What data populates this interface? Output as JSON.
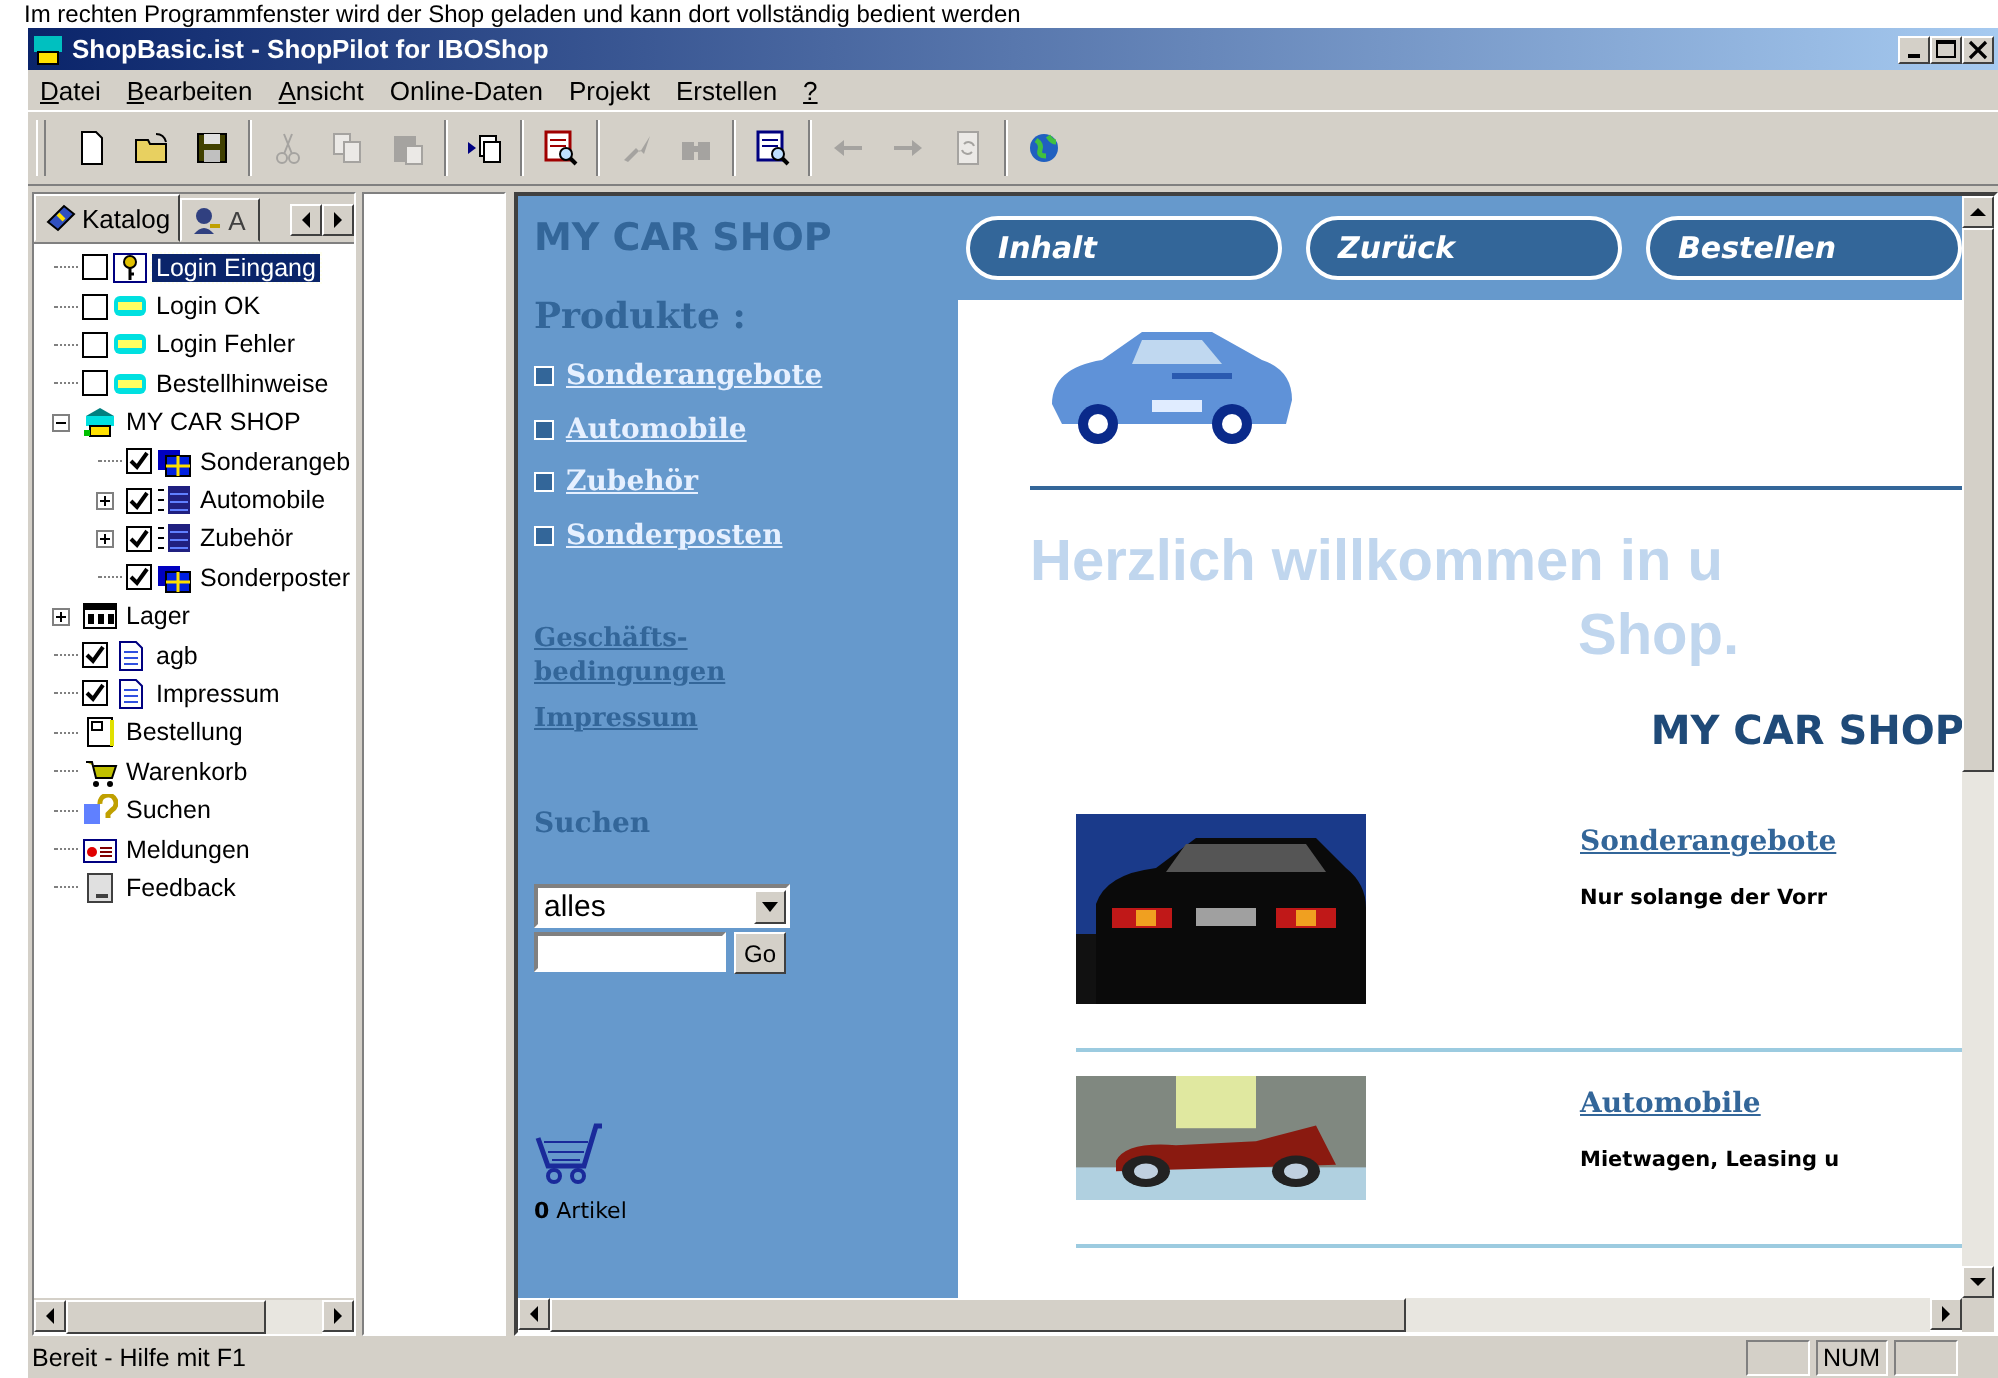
{
  "caption": "Im rechten Programmfenster wird der Shop geladen und kann dort vollständig bedient werden",
  "window": {
    "title": "ShopBasic.ist - ShopPilot for IBOShop"
  },
  "menu": [
    {
      "label": "Datei",
      "underline_first": true
    },
    {
      "label": "Bearbeiten",
      "underline_first": true
    },
    {
      "label": "Ansicht",
      "underline_first": true
    },
    {
      "label": "Online-Daten",
      "underline_first": false
    },
    {
      "label": "Projekt",
      "underline_first": false
    },
    {
      "label": "Erstellen",
      "underline_first": false
    },
    {
      "label": "?",
      "underline_first": true
    }
  ],
  "toolbar": [
    [
      {
        "kind": "new",
        "disabled": false
      },
      {
        "kind": "open",
        "disabled": false
      },
      {
        "kind": "save",
        "disabled": false
      }
    ],
    [
      {
        "kind": "cut",
        "disabled": true
      },
      {
        "kind": "copy",
        "disabled": true
      },
      {
        "kind": "paste",
        "disabled": true
      }
    ],
    [
      {
        "kind": "import",
        "disabled": false
      }
    ],
    [
      {
        "kind": "preview",
        "disabled": false
      }
    ],
    [
      {
        "kind": "tool",
        "disabled": true
      },
      {
        "kind": "find",
        "disabled": true
      }
    ],
    [
      {
        "kind": "view",
        "disabled": false
      }
    ],
    [
      {
        "kind": "back",
        "disabled": true
      },
      {
        "kind": "forward",
        "disabled": true
      },
      {
        "kind": "refresh",
        "disabled": true
      }
    ],
    [
      {
        "kind": "globe",
        "disabled": false
      }
    ]
  ],
  "tabs": [
    {
      "label": "Katalog",
      "selected": true
    },
    {
      "label": "A",
      "selected": false
    }
  ],
  "tree": [
    {
      "label": "Login Eingang",
      "kind": "key",
      "checked": false,
      "selected": true
    },
    {
      "label": "Login OK",
      "kind": "shop",
      "checked": false,
      "selected": false
    },
    {
      "label": "Login Fehler",
      "kind": "shop",
      "checked": false,
      "selected": false
    },
    {
      "label": "Bestellhinweise",
      "kind": "shop",
      "checked": false,
      "selected": false
    },
    {
      "label": "MY CAR SHOP",
      "kind": "store",
      "selected": false,
      "expanded": true,
      "children": [
        {
          "label": "Sonderangeb",
          "kind": "folder",
          "checked": true,
          "selected": false
        },
        {
          "label": "Automobile",
          "kind": "list",
          "checked": true,
          "selected": false,
          "expanded": false
        },
        {
          "label": "Zubehör",
          "kind": "list",
          "checked": true,
          "selected": false,
          "expanded": false
        },
        {
          "label": "Sonderposter",
          "kind": "folder",
          "checked": true,
          "selected": false
        }
      ]
    },
    {
      "label": "Lager",
      "kind": "stock",
      "selected": false,
      "expanded": false
    },
    {
      "label": "agb",
      "kind": "page",
      "checked": true,
      "selected": false
    },
    {
      "label": "Impressum",
      "kind": "page",
      "checked": true,
      "selected": false
    },
    {
      "label": "Bestellung",
      "kind": "form",
      "selected": false
    },
    {
      "label": "Warenkorb",
      "kind": "cart",
      "selected": false
    },
    {
      "label": "Suchen",
      "kind": "search",
      "selected": false
    },
    {
      "label": "Meldungen",
      "kind": "message",
      "selected": false
    },
    {
      "label": "Feedback",
      "kind": "feedback",
      "selected": false
    }
  ],
  "web": {
    "brand": "MY CAR SHOP",
    "nav_buttons": [
      "Inhalt",
      "Zurück",
      "Bestellen"
    ],
    "products_heading": "Produkte :",
    "product_links": [
      "Sonderangebote",
      "Automobile",
      "Zubehör",
      "Sonderposten"
    ],
    "info_links": [
      "Geschäfts-bedingungen",
      "Impressum"
    ],
    "search_heading": "Suchen",
    "search_select": "alles",
    "go_button": "Go",
    "cart_count": "0",
    "cart_label": "Artikel",
    "welcome_lines": [
      "Herzlich willkommen in u",
      "Shop."
    ],
    "subtitle": "MY CAR SHOP",
    "categories": [
      {
        "title": "Sonderangebote",
        "text": "Nur solange der Vorr",
        "kind": "picture"
      },
      {
        "title": "Automobile",
        "text": "Mietwagen, Leasing u",
        "kind": "picture"
      }
    ]
  },
  "status_bar": {
    "text": "Bereit - Hilfe mit F1",
    "indicators": [
      "NUM"
    ]
  }
}
